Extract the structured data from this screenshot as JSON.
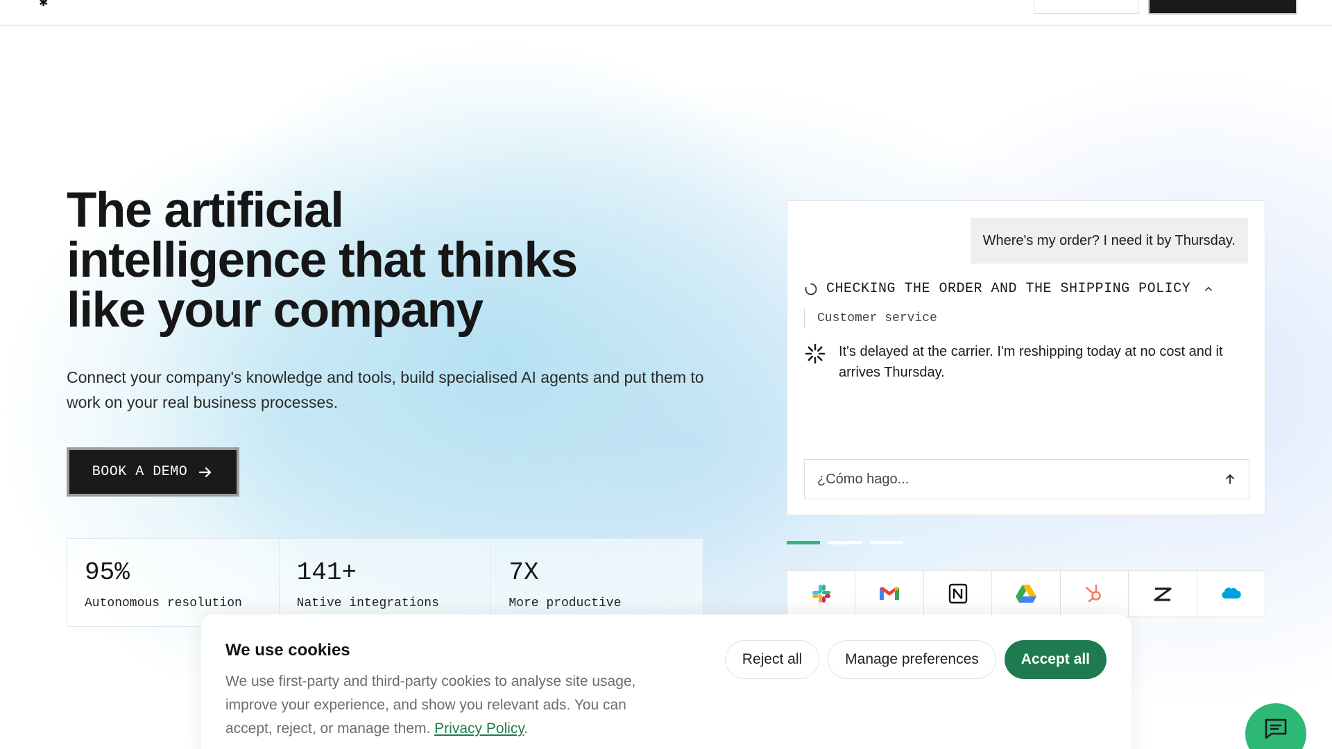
{
  "hero": {
    "title": "The artificial\nintelligence that thinks\nlike your company",
    "subtitle": "Connect your company's knowledge and tools, build specialised AI agents and put them to work on your real business processes.",
    "cta_label": "BOOK A DEMO"
  },
  "stats": [
    {
      "value": "95%",
      "label": "Autonomous resolution"
    },
    {
      "value": "141+",
      "label": "Native integrations"
    },
    {
      "value": "7X",
      "label": "More productive"
    }
  ],
  "chat_demo": {
    "user_message": "Where's my order? I need it by Thursday.",
    "thinking_label": "CHECKING THE ORDER AND THE SHIPPING POLICY",
    "agent_name": "Customer service",
    "answer": "It's delayed at the carrier. I'm reshipping today at no cost and it arrives Thursday.",
    "input_placeholder": "¿Cómo hago...",
    "carousel": {
      "count": 3,
      "active_index": 0
    }
  },
  "integrations": [
    {
      "name": "Slack",
      "icon": "slack-icon"
    },
    {
      "name": "Gmail",
      "icon": "gmail-icon"
    },
    {
      "name": "Notion",
      "icon": "notion-icon"
    },
    {
      "name": "Google Drive",
      "icon": "google-drive-icon"
    },
    {
      "name": "HubSpot",
      "icon": "hubspot-icon"
    },
    {
      "name": "Zendesk",
      "icon": "zendesk-icon"
    },
    {
      "name": "Salesforce",
      "icon": "salesforce-icon"
    }
  ],
  "cookie_banner": {
    "title": "We use cookies",
    "body": "We use first-party and third-party cookies to analyse site usage, improve your experience, and show you relevant ads. You can accept, reject, or manage them.",
    "privacy_link": "Privacy Policy",
    "reject_label": "Reject all",
    "manage_label": "Manage preferences",
    "accept_label": "Accept all"
  },
  "colors": {
    "accent_green": "#2db875",
    "cookie_primary": "#1f7a4f",
    "dark": "#1a1a1a"
  }
}
